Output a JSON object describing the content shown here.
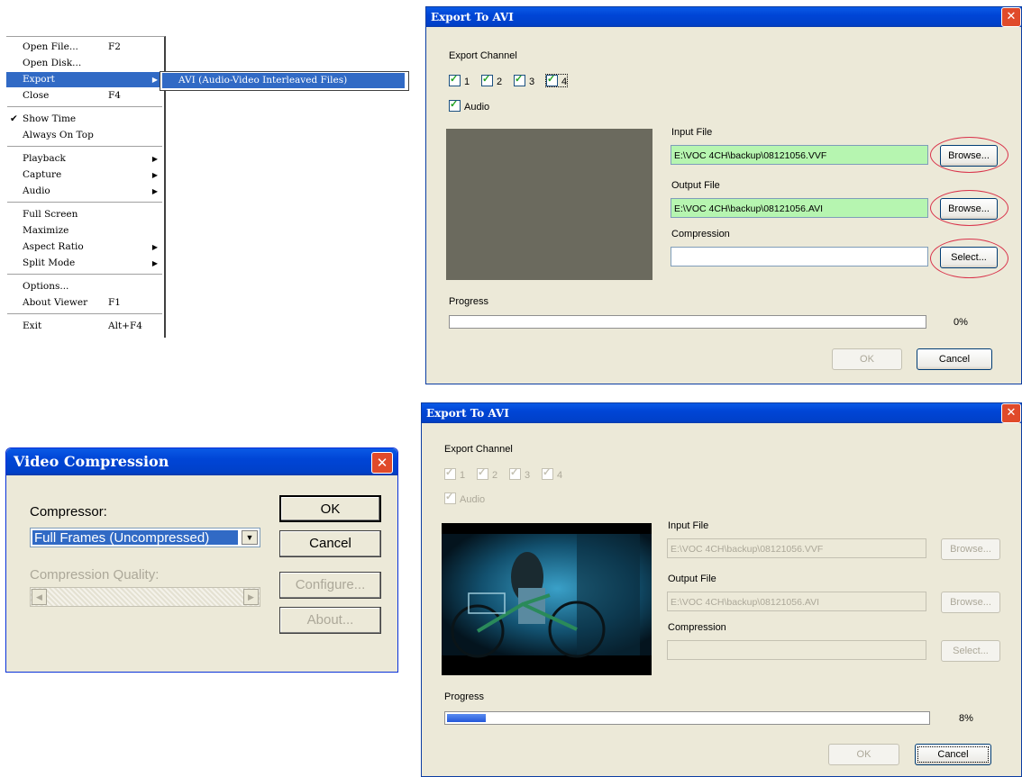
{
  "menu": {
    "items": [
      {
        "label": "Open File...",
        "accel": "F2",
        "arrow": ""
      },
      {
        "label": "Open Disk...",
        "accel": "",
        "arrow": ""
      },
      {
        "label": "Export",
        "accel": "",
        "arrow": "▶"
      },
      {
        "label": "Close",
        "accel": "F4",
        "arrow": ""
      },
      {
        "label": "Show Time",
        "accel": "",
        "arrow": "",
        "checked": "✔"
      },
      {
        "label": "Always On Top",
        "accel": "",
        "arrow": ""
      },
      {
        "label": "Playback",
        "accel": "",
        "arrow": "▶"
      },
      {
        "label": "Capture",
        "accel": "",
        "arrow": "▶"
      },
      {
        "label": "Audio",
        "accel": "",
        "arrow": "▶"
      },
      {
        "label": "Full Screen",
        "accel": "",
        "arrow": ""
      },
      {
        "label": "Maximize",
        "accel": "",
        "arrow": ""
      },
      {
        "label": "Aspect Ratio",
        "accel": "",
        "arrow": "▶"
      },
      {
        "label": "Split Mode",
        "accel": "",
        "arrow": "▶"
      },
      {
        "label": "Options...",
        "accel": "",
        "arrow": ""
      },
      {
        "label": "About Viewer",
        "accel": "F1",
        "arrow": ""
      },
      {
        "label": "Exit",
        "accel": "Alt+F4",
        "arrow": ""
      }
    ],
    "submenu_item": "AVI (Audio-Video Interleaved Files)"
  },
  "export_dialog_1": {
    "title": "Export To AVI",
    "close": "✕",
    "export_channel_label": "Export Channel",
    "channels": [
      "1",
      "2",
      "3",
      "4"
    ],
    "audio_label": "Audio",
    "input_file_label": "Input File",
    "input_file_value": "E:\\VOC 4CH\\backup\\08121056.VVF",
    "output_file_label": "Output File",
    "output_file_value": "E:\\VOC 4CH\\backup\\08121056.AVI",
    "compression_label": "Compression",
    "compression_value": "",
    "browse_label": "Browse...",
    "select_label": "Select...",
    "progress_label": "Progress",
    "progress_percent": "0%",
    "progress_value": 0,
    "ok_label": "OK",
    "cancel_label": "Cancel"
  },
  "export_dialog_2": {
    "title": "Export To AVI",
    "close": "✕",
    "export_channel_label": "Export Channel",
    "channels": [
      "1",
      "2",
      "3",
      "4"
    ],
    "audio_label": "Audio",
    "input_file_label": "Input File",
    "input_file_value": "E:\\VOC 4CH\\backup\\08121056.VVF",
    "output_file_label": "Output File",
    "output_file_value": "E:\\VOC 4CH\\backup\\08121056.AVI",
    "compression_label": "Compression",
    "compression_value": "",
    "browse_label": "Browse...",
    "select_label": "Select...",
    "progress_label": "Progress",
    "progress_percent": "8%",
    "progress_value": 8,
    "ok_label": "OK",
    "cancel_label": "Cancel"
  },
  "video_compression": {
    "title": "Video Compression",
    "close": "✕",
    "compressor_label": "Compressor:",
    "compressor_value": "Full Frames (Uncompressed)",
    "quality_label": "Compression Quality:",
    "ok_label": "OK",
    "cancel_label": "Cancel",
    "configure_label": "Configure...",
    "about_label": "About..."
  },
  "colors": {
    "title_blue": "#0045d6",
    "highlight": "#316ac5",
    "dialog_bg": "#ece9d8",
    "field_green": "#b6f5b0",
    "annotation_red": "#d9324a",
    "progress_blue": "#2458d8"
  }
}
